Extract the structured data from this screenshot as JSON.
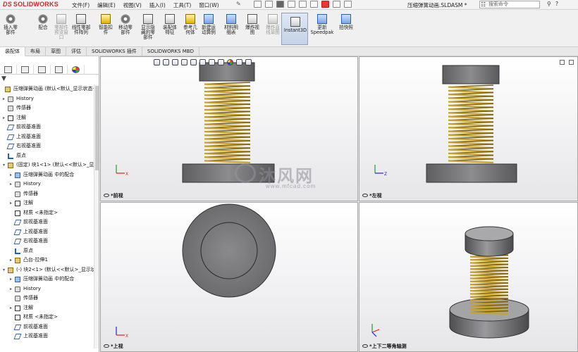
{
  "app": {
    "brand": "SOLIDWORKS",
    "menus": [
      "文件(F)",
      "编辑(E)",
      "视图(V)",
      "插入(I)",
      "工具(T)",
      "窗口(W)"
    ],
    "doc_title": "压缩弹簧动画.SLDASM *",
    "search_placeholder": "搜索命令"
  },
  "ribbon": {
    "buttons": [
      {
        "label": "插入零\n部件",
        "icon": "insert-component-icon",
        "enabled": true
      },
      {
        "label": "配合",
        "icon": "mate-icon",
        "enabled": true
      },
      {
        "label": "零部件\n预览窗\n口",
        "icon": "component-preview-icon",
        "enabled": false
      },
      {
        "label": "线性零部\n件阵列",
        "icon": "linear-pattern-icon",
        "enabled": true
      },
      {
        "label": "智能扣\n件",
        "icon": "smart-fastener-icon",
        "enabled": true
      },
      {
        "label": "移动零\n部件",
        "icon": "move-component-icon",
        "enabled": true
      },
      {
        "label": "显示隐\n藏的零\n部件",
        "icon": "show-hidden-icon",
        "enabled": true
      },
      {
        "label": "装配体\n特征",
        "icon": "assembly-feature-icon",
        "enabled": true
      },
      {
        "label": "参考几\n何体",
        "icon": "reference-geometry-icon",
        "enabled": true
      },
      {
        "label": "新建运\n动算例",
        "icon": "motion-study-icon",
        "enabled": true
      },
      {
        "label": "材料明\n细表",
        "icon": "bom-icon",
        "enabled": true
      },
      {
        "label": "爆炸视\n图",
        "icon": "explode-icon",
        "enabled": true
      },
      {
        "label": "爆炸直\n线草图",
        "icon": "explode-line-icon",
        "enabled": false
      },
      {
        "label": "Instant3D",
        "icon": "instant3d-icon",
        "enabled": true,
        "active": true
      },
      {
        "label": "更新\nSpeedpak",
        "icon": "speedpak-icon",
        "enabled": true
      },
      {
        "label": "拍快照",
        "icon": "snapshot-icon",
        "enabled": true
      }
    ]
  },
  "tabs": [
    "装配体",
    "布局",
    "草图",
    "评估",
    "SOLIDWORKS 插件",
    "SOLIDWORKS MBD"
  ],
  "active_tab": "装配体",
  "tree": [
    {
      "label": "压缩弹簧动画 (默认<默认_显示状态-",
      "icon": "assembly-icon",
      "level": 0,
      "expander": ""
    },
    {
      "label": "History",
      "icon": "history-icon",
      "level": 1,
      "expander": "▸"
    },
    {
      "label": "传感器",
      "icon": "sensor-icon",
      "level": 1,
      "expander": ""
    },
    {
      "label": "注解",
      "icon": "annotation-icon",
      "level": 1,
      "expander": "▸"
    },
    {
      "label": "前视基准面",
      "icon": "plane-icon",
      "level": 1,
      "expander": ""
    },
    {
      "label": "上视基准面",
      "icon": "plane-icon",
      "level": 1,
      "expander": ""
    },
    {
      "label": "右视基准面",
      "icon": "plane-icon",
      "level": 1,
      "expander": ""
    },
    {
      "label": "原点",
      "icon": "origin-icon",
      "level": 1,
      "expander": ""
    },
    {
      "label": "(固定) 块1<1> (默认<<默认>_显",
      "icon": "part-icon",
      "level": 1,
      "expander": "▾"
    },
    {
      "label": "压缩弹簧动画 中的配合",
      "icon": "mates-icon",
      "level": 2,
      "expander": "▸"
    },
    {
      "label": "History",
      "icon": "history-icon",
      "level": 2,
      "expander": "▸"
    },
    {
      "label": "传感器",
      "icon": "sensor-icon",
      "level": 2,
      "expander": ""
    },
    {
      "label": "注解",
      "icon": "annotation-icon",
      "level": 2,
      "expander": "▸"
    },
    {
      "label": "材质 <未指定>",
      "icon": "material-icon",
      "level": 2,
      "expander": ""
    },
    {
      "label": "前视基准面",
      "icon": "plane-icon",
      "level": 2,
      "expander": ""
    },
    {
      "label": "上视基准面",
      "icon": "plane-icon",
      "level": 2,
      "expander": ""
    },
    {
      "label": "右视基准面",
      "icon": "plane-icon",
      "level": 2,
      "expander": ""
    },
    {
      "label": "原点",
      "icon": "origin-icon",
      "level": 2,
      "expander": ""
    },
    {
      "label": "凸台-拉伸1",
      "icon": "extrude-icon",
      "level": 2,
      "expander": "▸"
    },
    {
      "label": "(-) 块2<1> (默认<<默认>_显示状",
      "icon": "part-icon",
      "level": 1,
      "expander": "▾"
    },
    {
      "label": "压缩弹簧动画 中的配合",
      "icon": "mates-icon",
      "level": 2,
      "expander": "▸"
    },
    {
      "label": "History",
      "icon": "history-icon",
      "level": 2,
      "expander": "▸"
    },
    {
      "label": "传感器",
      "icon": "sensor-icon",
      "level": 2,
      "expander": ""
    },
    {
      "label": "注解",
      "icon": "annotation-icon",
      "level": 2,
      "expander": "▸"
    },
    {
      "label": "材质 <未指定>",
      "icon": "material-icon",
      "level": 2,
      "expander": ""
    },
    {
      "label": "前视基准面",
      "icon": "plane-icon",
      "level": 2,
      "expander": ""
    },
    {
      "label": "上视基准面",
      "icon": "plane-icon",
      "level": 2,
      "expander": ""
    }
  ],
  "viewports": {
    "front": "*前视",
    "left": "*左视",
    "top": "*上视",
    "iso": "*上下二等角轴测"
  },
  "watermark": {
    "text": "沐风网",
    "url": "www.mfcad.com"
  },
  "colors": {
    "brand": "#d2232a",
    "spring": "#c9a227",
    "part": "#7d7d80"
  }
}
